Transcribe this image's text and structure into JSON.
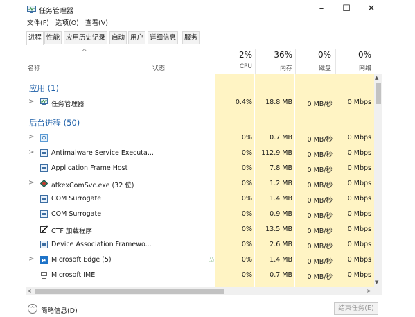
{
  "window": {
    "title": "任务管理器",
    "controls": {
      "minimize": "–",
      "maximize": "☐",
      "close": "✕"
    }
  },
  "menu": [
    "文件(F)",
    "选项(O)",
    "查看(V)"
  ],
  "tabs": [
    "进程",
    "性能",
    "应用历史记录",
    "启动",
    "用户",
    "详细信息",
    "服务"
  ],
  "columns": {
    "sort_arrow": "^",
    "name": "名称",
    "status": "状态",
    "cpu": {
      "pct": "2%",
      "label": "CPU"
    },
    "memory": {
      "pct": "36%",
      "label": "内存"
    },
    "disk": {
      "pct": "0%",
      "label": "磁盘"
    },
    "network": {
      "pct": "0%",
      "label": "网络"
    }
  },
  "groups": {
    "apps": "应用 (1)",
    "background": "后台进程 (50)"
  },
  "app_rows": [
    {
      "name": "任务管理器",
      "cpu": "0.4%",
      "mem": "18.8 MB",
      "disk": "0 MB/秒",
      "net": "0 Mbps",
      "expand": ">"
    }
  ],
  "bg_rows": [
    {
      "name": "",
      "cpu": "0%",
      "mem": "0.7 MB",
      "disk": "0 MB/秒",
      "net": "0 Mbps",
      "expand": ">",
      "icon": "gear-icon"
    },
    {
      "name": "Antimalware Service Executa...",
      "cpu": "0%",
      "mem": "112.9 MB",
      "disk": "0 MB/秒",
      "net": "0 Mbps",
      "expand": ">",
      "icon": "window-icon"
    },
    {
      "name": "Application Frame Host",
      "cpu": "0%",
      "mem": "7.8 MB",
      "disk": "0 MB/秒",
      "net": "0 Mbps",
      "expand": "",
      "icon": "window-icon"
    },
    {
      "name": "atkexComSvc.exe (32 位)",
      "cpu": "0%",
      "mem": "1.2 MB",
      "disk": "0 MB/秒",
      "net": "0 Mbps",
      "expand": ">",
      "icon": "diamond-icon"
    },
    {
      "name": "COM Surrogate",
      "cpu": "0%",
      "mem": "1.4 MB",
      "disk": "0 MB/秒",
      "net": "0 Mbps",
      "expand": "",
      "icon": "window-icon"
    },
    {
      "name": "COM Surrogate",
      "cpu": "0%",
      "mem": "0.9 MB",
      "disk": "0 MB/秒",
      "net": "0 Mbps",
      "expand": "",
      "icon": "window-icon"
    },
    {
      "name": "CTF 加载程序",
      "cpu": "0%",
      "mem": "13.5 MB",
      "disk": "0 MB/秒",
      "net": "0 Mbps",
      "expand": "",
      "icon": "pen-icon"
    },
    {
      "name": "Device Association Framewo...",
      "cpu": "0%",
      "mem": "2.6 MB",
      "disk": "0 MB/秒",
      "net": "0 Mbps",
      "expand": "",
      "icon": "window-icon"
    },
    {
      "name": "Microsoft Edge (5)",
      "cpu": "0%",
      "mem": "1.4 MB",
      "disk": "0 MB/秒",
      "net": "0 Mbps",
      "expand": ">",
      "icon": "edge-icon",
      "status_icon": "leaf-icon"
    },
    {
      "name": "Microsoft IME",
      "cpu": "0%",
      "mem": "0.7 MB",
      "disk": "0 MB/秒",
      "net": "0 Mbps",
      "expand": "",
      "icon": "ime-icon"
    }
  ],
  "scroll": {
    "up": "▲",
    "down": "▼",
    "left": "<",
    "right": ">"
  },
  "footer": {
    "toggle_glyph": "^",
    "fewer_details": "简略信息(D)",
    "end_task": "结束任务(E)"
  }
}
